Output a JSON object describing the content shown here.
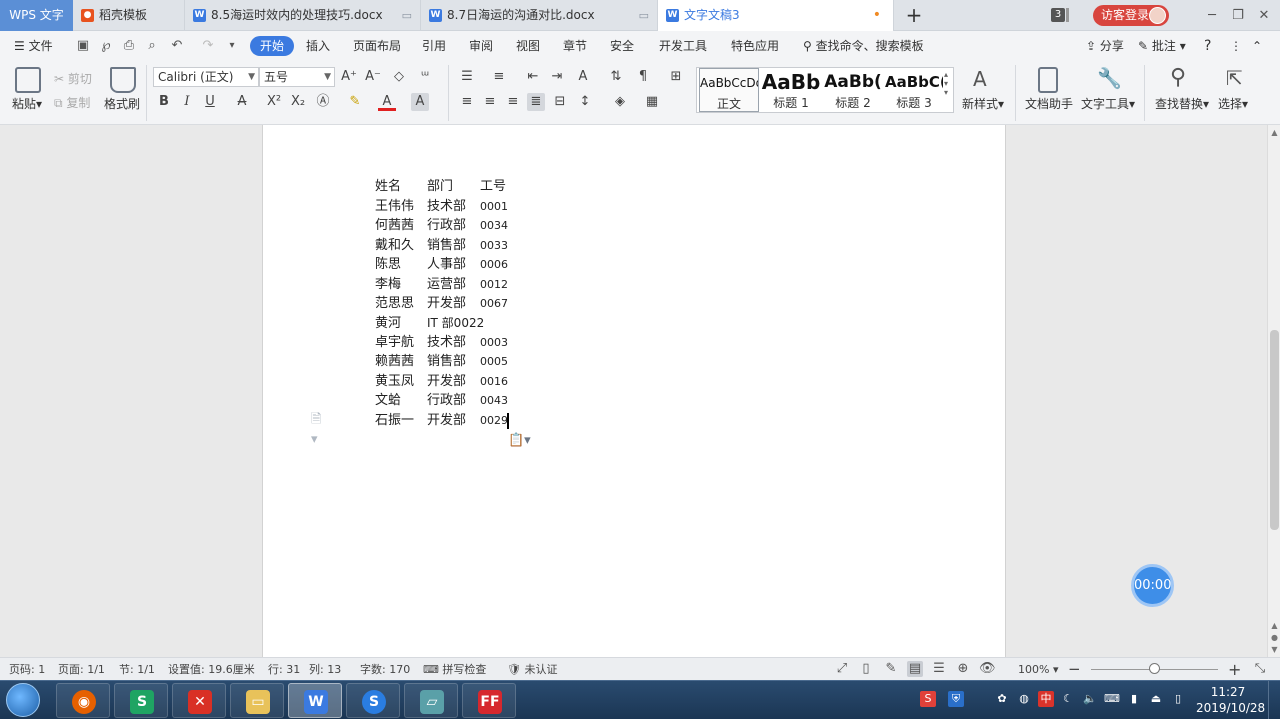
{
  "titlebar": {
    "wps_tab": "WPS 文字",
    "tabs": [
      {
        "label": "稻壳模板",
        "icon": "docer-icon"
      },
      {
        "label": "8.5海运时效内的处理技巧.docx",
        "icon": "word-doc-icon"
      },
      {
        "label": "8.7日海运的沟通对比.docx",
        "icon": "word-doc-icon"
      },
      {
        "label": "文字文稿3",
        "icon": "word-doc-icon",
        "active": true
      }
    ],
    "new_tab": "+",
    "window_count": "3",
    "login": "访客登录",
    "controls": [
      "─",
      "❐",
      "✕"
    ]
  },
  "menubar": {
    "file": "文件",
    "items": [
      "开始",
      "插入",
      "页面布局",
      "引用",
      "审阅",
      "视图",
      "章节",
      "安全",
      "开发工具",
      "特色应用"
    ],
    "active": "开始",
    "search": "查找命令、搜索模板",
    "share": "分享",
    "comment": "批注",
    "help": "?"
  },
  "ribbon": {
    "paste": "粘贴",
    "cut": "剪切",
    "copy": "复制",
    "format_painter": "格式刷",
    "font_name": "Calibri (正文)",
    "font_size": "五号",
    "styles": [
      {
        "preview": "AaBbCcDd",
        "name": "正文"
      },
      {
        "preview": "AaBb",
        "name": "标题 1"
      },
      {
        "preview": "AaBb(",
        "name": "标题 2"
      },
      {
        "preview": "AaBbC(",
        "name": "标题 3"
      }
    ],
    "new_style": "新样式",
    "doc_assistant": "文档助手",
    "text_tools": "文字工具",
    "find_replace": "查找替换",
    "select": "选择"
  },
  "document": {
    "header": [
      "姓名",
      "部门",
      "工号"
    ],
    "rows": [
      [
        "王伟伟",
        "技术部",
        "0001"
      ],
      [
        "何茜茜",
        "行政部",
        "0034"
      ],
      [
        "戴和久",
        "销售部",
        "0033"
      ],
      [
        "陈思",
        "人事部",
        "0006"
      ],
      [
        "李梅",
        "运营部",
        "0012"
      ],
      [
        "范思思",
        "开发部",
        "0067"
      ],
      [
        "黄河",
        "IT 部0022",
        ""
      ],
      [
        "卓宇航",
        "技术部",
        "0003"
      ],
      [
        "赖茜茜",
        "销售部",
        "0005"
      ],
      [
        "黄玉凤",
        "开发部",
        "0016"
      ],
      [
        "文蛤",
        "行政部",
        "0043"
      ],
      [
        "石振一",
        "开发部",
        "0029"
      ]
    ]
  },
  "timer": "00:00",
  "statusbar": {
    "page_num": "页码: 1",
    "pages": "页面: 1/1",
    "section": "节: 1/1",
    "setting": "设置值: 19.6厘米",
    "line": "行: 31",
    "column": "列: 13",
    "words": "字数: 170",
    "spell": "拼写检查",
    "auth": "未认证",
    "zoom": "100%",
    "zoom_level": 1.0
  },
  "taskbar": {
    "time": "11:27",
    "date": "2019/10/28"
  },
  "colors": {
    "accent": "#3b7ae0",
    "login_red": "#d8453e",
    "timer_blue": "#3e8ee8"
  }
}
